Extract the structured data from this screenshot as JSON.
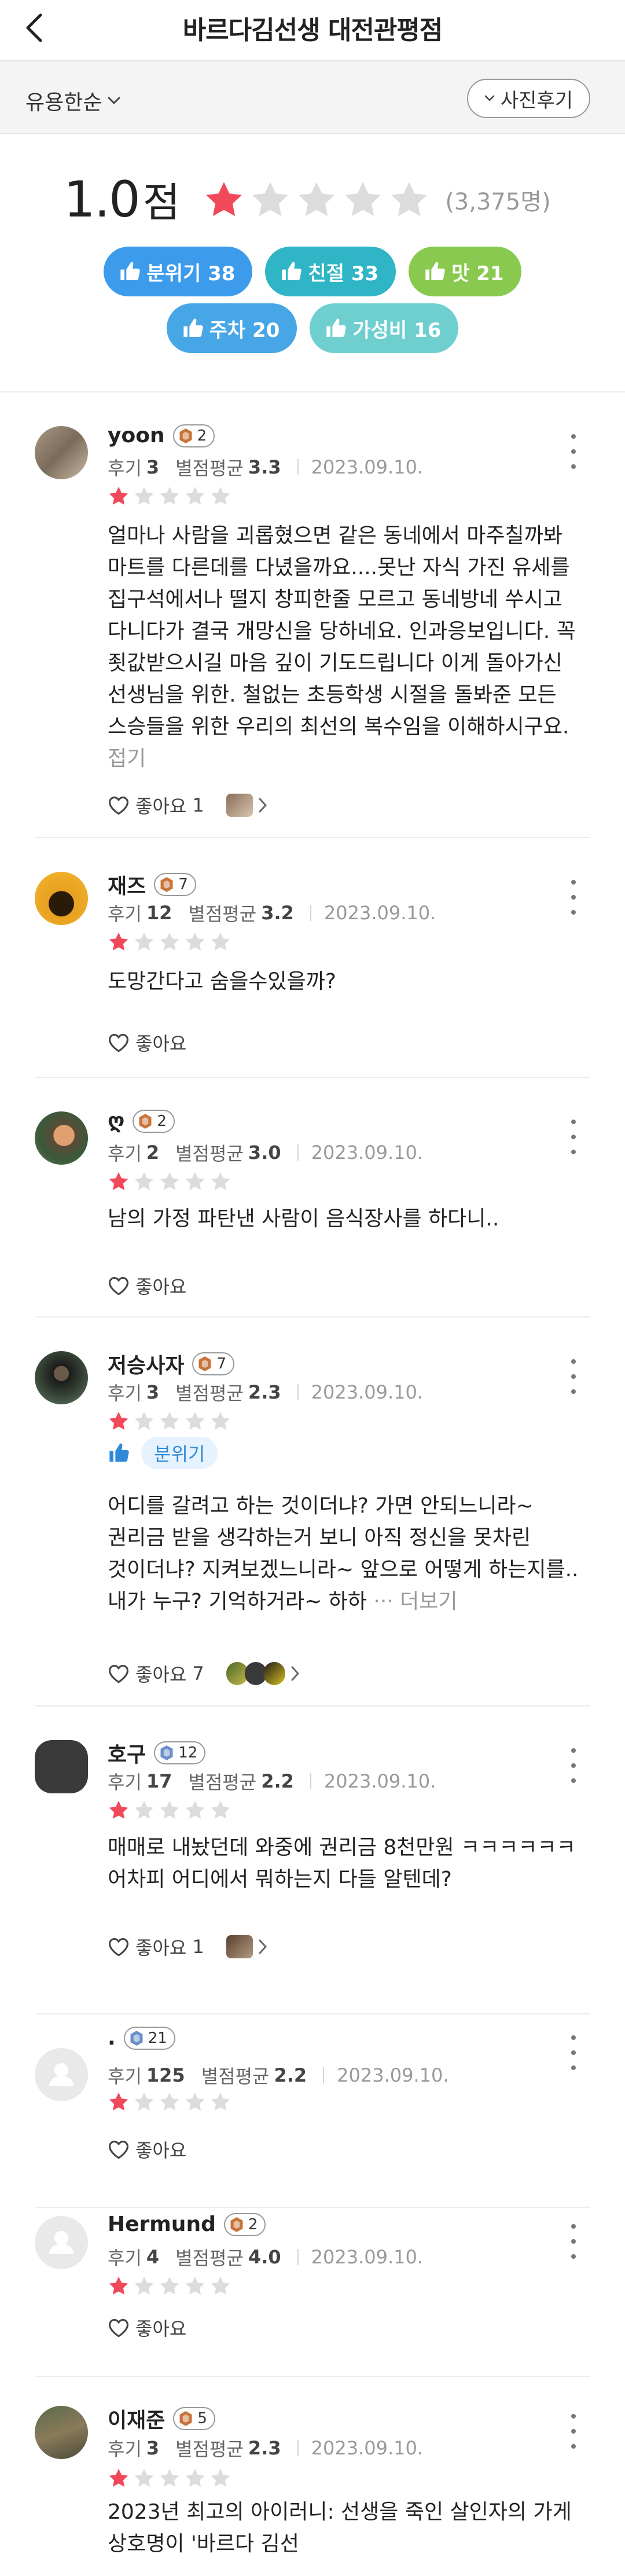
{
  "header": {
    "title": "바르다김선생 대전관평점"
  },
  "filters": {
    "sort_label": "유용한순",
    "photo_label": "사진후기"
  },
  "summary": {
    "score": "1.0",
    "unit": "점",
    "rating": 1,
    "review_count": "(3,375명)",
    "tags": [
      {
        "label": "분위기 38",
        "color": "#3d9bec"
      },
      {
        "label": "친절 33",
        "color": "#2fb5c5"
      },
      {
        "label": "맛 21",
        "color": "#89c94f"
      },
      {
        "label": "주차 20",
        "color": "#47a6e6"
      },
      {
        "label": "가성비 16",
        "color": "#6fcfcf"
      }
    ]
  },
  "like_label": "좋아요",
  "reviews": [
    {
      "name": "yoon",
      "level": "2",
      "level_type": "bronze",
      "review_count_label": "후기",
      "review_count": "3",
      "avg_label": "별점평균",
      "avg": "3.3",
      "date": "2023.09.10.",
      "rating": 1,
      "text": "얼마나 사람을 괴롭혔으면 같은 동네에서 마주칠까봐 마트를 다른데를 다녔을까요....못난 자식 가진 유세를 집구석에서나 떨지 창피한줄 모르고 동네방네 쑤시고 다니다가 결국 개망신을 당하네요. 인과응보입니다. 꼭 죗값받으시길 마음 깊이 기도드립니다 이게 돌아가신 선생님을 위한. 철없는 초등학생 시절을 돌봐준 모든 스승들을 위한 우리의 최선의 복수임을 이해하시구요.",
      "more": "접기",
      "likes": "1"
    },
    {
      "name": "재즈",
      "level": "7",
      "level_type": "bronze",
      "review_count_label": "후기",
      "review_count": "12",
      "avg_label": "별점평균",
      "avg": "3.2",
      "date": "2023.09.10.",
      "rating": 1,
      "text": "도망간다고 숨을수있을까?"
    },
    {
      "name": "ღ",
      "level": "2",
      "level_type": "bronze",
      "review_count_label": "후기",
      "review_count": "2",
      "avg_label": "별점평균",
      "avg": "3.0",
      "date": "2023.09.10.",
      "rating": 1,
      "text": "남의 가정 파탄낸 사람이 음식장사를 하다니.."
    },
    {
      "name": "저승사자",
      "level": "7",
      "level_type": "bronze",
      "review_count_label": "후기",
      "review_count": "3",
      "avg_label": "별점평균",
      "avg": "2.3",
      "date": "2023.09.10.",
      "rating": 1,
      "tag": "분위기",
      "text": "어디를 갈려고 하는 것이더냐? 가면 안되느니라~ 권리금 받을 생각하는거 보니 아직 정신을 못차린 것이더냐? 지켜보겠느니라~ 앞으로 어떻게 하는지를.. 내가 누구? 기억하거라~ 하하",
      "more": "··· 더보기",
      "likes": "7"
    },
    {
      "name": "호구",
      "level": "12",
      "level_type": "silver",
      "review_count_label": "후기",
      "review_count": "17",
      "avg_label": "별점평균",
      "avg": "2.2",
      "date": "2023.09.10.",
      "rating": 1,
      "text": "매매로 내놨던데 와중에 권리금 8천만원 ㅋㅋㅋㅋㅋㅋ 어차피 어디에서 뭐하는지 다들 알텐데?",
      "likes": "1"
    },
    {
      "name": ".",
      "level": "21",
      "level_type": "silver",
      "review_count_label": "후기",
      "review_count": "125",
      "avg_label": "별점평균",
      "avg": "2.2",
      "date": "2023.09.10.",
      "rating": 1
    },
    {
      "name": "Hermund",
      "level": "2",
      "level_type": "bronze",
      "review_count_label": "후기",
      "review_count": "4",
      "avg_label": "별점평균",
      "avg": "4.0",
      "date": "2023.09.10.",
      "rating": 1
    },
    {
      "name": "이재준",
      "level": "5",
      "level_type": "bronze",
      "review_count_label": "후기",
      "review_count": "3",
      "avg_label": "별점평균",
      "avg": "2.3",
      "date": "2023.09.10.",
      "rating": 1,
      "text": "2023년 최고의 아이러니: 선생을 죽인 살인자의 가게 상호명이 '바르다 김선"
    }
  ],
  "colors": {
    "star_on": "#f04a5a",
    "star_off": "#dcdcdc",
    "tag_chip": "#2e8ad9"
  }
}
